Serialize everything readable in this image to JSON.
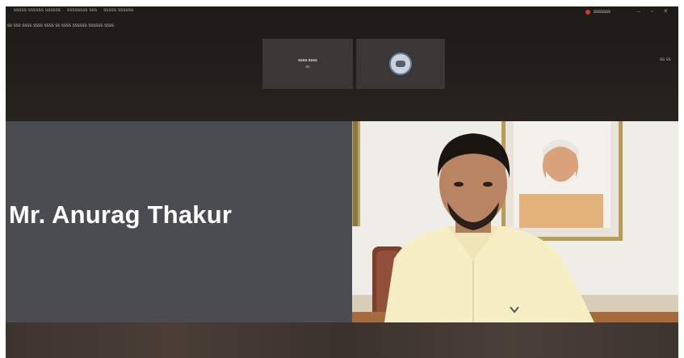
{
  "toolbar": {
    "tabs": [
      "sssss ssssss ssssss",
      "ssssssss sss",
      "sssss ssssss"
    ],
    "subtitle": "ss sss ssss ssss ssss ss ssss ssssss ssssss ssss",
    "recording_text": "sssssss",
    "view_label": "ss ss"
  },
  "participants": [
    {
      "name": "ssss ssss",
      "subtitle": "ss"
    },
    {
      "name": "",
      "subtitle": ""
    }
  ],
  "speaker": {
    "name": "Mr. Anurag Thakur"
  },
  "colors": {
    "name_panel": "#4a4c51",
    "toolbar": "#1e1b19",
    "recording": "#d23a2c"
  },
  "icons": [
    "recording-icon",
    "minimize-icon",
    "maximize-icon",
    "close-icon",
    "participant-avatar-icon"
  ]
}
